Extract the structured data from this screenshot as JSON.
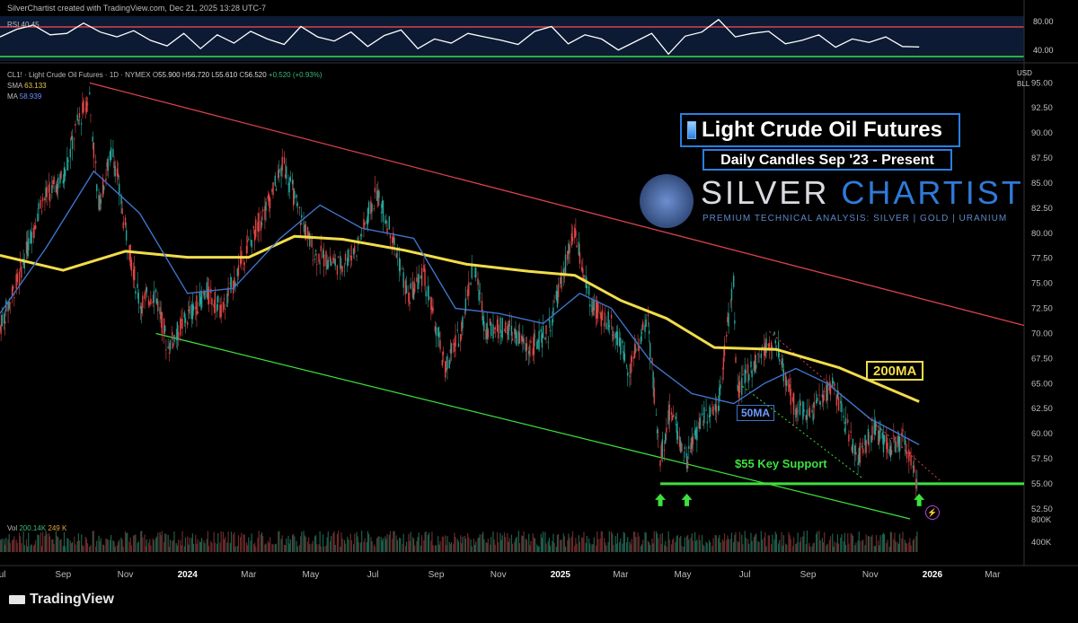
{
  "header": {
    "credit": "SilverChartist created with TradingView.com, Dec 21, 2025 13:28 UTC-7"
  },
  "legend": {
    "symbol_line": "CL1! · Light Crude Oil Futures · 1D · NYMEX",
    "ohlc": {
      "o_label": "O",
      "o": "55.900",
      "h_label": "H",
      "h": "56.720",
      "l_label": "L",
      "l": "55.610",
      "c_label": "C",
      "c": "56.520",
      "chg": "+0.520 (+0.93%)"
    },
    "sma_label": "SMA",
    "sma_value": "63.133",
    "ma_label": "MA",
    "ma_value": "58.939"
  },
  "rsi_panel": {
    "label": "RSI 40.45",
    "ticks": [
      "80.00",
      "40.00"
    ],
    "upper_color": "#e04545",
    "lower_color": "#3de03d"
  },
  "volume_panel": {
    "label": "Vol",
    "v1": "200.14K",
    "v2": "249 K",
    "ticks": [
      "800K",
      "400K"
    ]
  },
  "price_scale": {
    "currency": "USD",
    "unit": "BLL"
  },
  "annotations": {
    "title": "Light Crude Oil Futures",
    "subtitle": "Daily Candles Sep '23 - Present",
    "logo_word_a": "SILVER",
    "logo_word_b": "CHARTIST",
    "logo_tag": "PREMIUM TECHNICAL ANALYSIS: SILVER | GOLD | URANIUM",
    "ma200_tag": "200MA",
    "ma50_tag": "50MA",
    "support_label": "$55 Key Support",
    "bolt_icon": "lightning-icon"
  },
  "footer": {
    "brand": "TradingView",
    "brand_icon": "tradingview-logo-icon"
  },
  "colors": {
    "up": "#26a69a",
    "down": "#e04545",
    "ma200": "#f2dc4a",
    "ma50": "#3e73c9",
    "resistance": "#d9414f",
    "support_channel": "#3de03d",
    "support_line": "#3de03d",
    "arrows": "#3de03d"
  },
  "chart_data": {
    "type": "line",
    "title": "Light Crude Oil Futures",
    "subtitle": "Daily Candles Sep '23 - Present",
    "x_ticks": [
      "Jul",
      "Sep",
      "Nov",
      "2024",
      "Mar",
      "May",
      "Jul",
      "Sep",
      "Nov",
      "2025",
      "Mar",
      "May",
      "Jul",
      "Sep",
      "Nov",
      "2026",
      "Mar"
    ],
    "x_tick_dates": [
      "2023-07-01",
      "2023-09-01",
      "2023-11-01",
      "2024-01-01",
      "2024-03-01",
      "2024-05-01",
      "2024-07-01",
      "2024-09-01",
      "2024-11-01",
      "2025-01-01",
      "2025-03-01",
      "2025-05-01",
      "2025-07-01",
      "2025-09-01",
      "2025-11-01",
      "2026-01-01",
      "2026-03-01"
    ],
    "x_range": [
      "2023-07-01",
      "2026-04-01"
    ],
    "y_ticks": [
      95,
      92.5,
      90,
      87.5,
      85,
      82.5,
      80,
      77.5,
      75,
      72.5,
      70,
      67.5,
      65,
      62.5,
      60,
      57.5,
      55,
      52.5
    ],
    "ylim": [
      51.5,
      97
    ],
    "price_series": {
      "name": "CL1!",
      "points": [
        [
          "2023-07-01",
          70.5
        ],
        [
          "2023-07-20",
          75.6
        ],
        [
          "2023-08-10",
          83.0
        ],
        [
          "2023-09-01",
          85.5
        ],
        [
          "2023-09-15",
          90.8
        ],
        [
          "2023-09-27",
          93.7
        ],
        [
          "2023-10-06",
          82.8
        ],
        [
          "2023-10-20",
          88.5
        ],
        [
          "2023-11-01",
          80.5
        ],
        [
          "2023-11-16",
          73.0
        ],
        [
          "2023-12-01",
          74.1
        ],
        [
          "2023-12-13",
          68.6
        ],
        [
          "2024-01-01",
          71.6
        ],
        [
          "2024-01-20",
          74.1
        ],
        [
          "2024-02-05",
          72.3
        ],
        [
          "2024-02-28",
          78.3
        ],
        [
          "2024-03-20",
          82.8
        ],
        [
          "2024-04-05",
          87.0
        ],
        [
          "2024-04-20",
          82.0
        ],
        [
          "2024-05-05",
          78.0
        ],
        [
          "2024-05-30",
          76.8
        ],
        [
          "2024-06-15",
          78.5
        ],
        [
          "2024-07-05",
          84.0
        ],
        [
          "2024-07-20",
          80.0
        ],
        [
          "2024-08-05",
          73.5
        ],
        [
          "2024-08-20",
          76.0
        ],
        [
          "2024-09-10",
          66.5
        ],
        [
          "2024-09-25",
          70.0
        ],
        [
          "2024-10-08",
          77.0
        ],
        [
          "2024-10-20",
          70.5
        ],
        [
          "2024-11-10",
          70.5
        ],
        [
          "2024-12-01",
          68.5
        ],
        [
          "2024-12-20",
          70.0
        ],
        [
          "2025-01-15",
          80.0
        ],
        [
          "2025-02-01",
          72.5
        ],
        [
          "2025-02-20",
          71.0
        ],
        [
          "2025-03-10",
          66.5
        ],
        [
          "2025-03-28",
          71.5
        ],
        [
          "2025-04-09",
          57.5
        ],
        [
          "2025-04-20",
          62.5
        ],
        [
          "2025-05-05",
          57.2
        ],
        [
          "2025-05-20",
          61.5
        ],
        [
          "2025-06-05",
          63.0
        ],
        [
          "2025-06-20",
          75.0
        ],
        [
          "2025-06-24",
          64.0
        ],
        [
          "2025-07-10",
          67.0
        ],
        [
          "2025-07-30",
          69.5
        ],
        [
          "2025-08-20",
          62.5
        ],
        [
          "2025-09-05",
          62.0
        ],
        [
          "2025-09-25",
          65.0
        ],
        [
          "2025-10-20",
          57.5
        ],
        [
          "2025-11-05",
          60.5
        ],
        [
          "2025-11-20",
          58.5
        ],
        [
          "2025-12-05",
          59.5
        ],
        [
          "2025-12-16",
          55.3
        ],
        [
          "2025-12-19",
          56.52
        ]
      ]
    },
    "series": [
      {
        "name": "200MA",
        "points": [
          [
            "2023-07-01",
            77.8
          ],
          [
            "2023-09-01",
            76.3
          ],
          [
            "2023-11-01",
            78.2
          ],
          [
            "2024-01-01",
            77.6
          ],
          [
            "2024-03-01",
            77.6
          ],
          [
            "2024-04-15",
            79.7
          ],
          [
            "2024-06-01",
            79.4
          ],
          [
            "2024-08-01",
            78.3
          ],
          [
            "2024-10-01",
            76.9
          ],
          [
            "2024-12-01",
            76.2
          ],
          [
            "2025-01-15",
            75.8
          ],
          [
            "2025-03-01",
            73.3
          ],
          [
            "2025-04-15",
            71.5
          ],
          [
            "2025-06-01",
            68.6
          ],
          [
            "2025-08-01",
            68.4
          ],
          [
            "2025-10-01",
            66.6
          ],
          [
            "2025-12-19",
            63.2
          ]
        ]
      },
      {
        "name": "50MA",
        "points": [
          [
            "2023-07-01",
            72.0
          ],
          [
            "2023-08-15",
            78.5
          ],
          [
            "2023-10-01",
            86.2
          ],
          [
            "2023-11-15",
            82.0
          ],
          [
            "2024-01-01",
            74.0
          ],
          [
            "2024-02-15",
            74.5
          ],
          [
            "2024-04-01",
            79.5
          ],
          [
            "2024-05-10",
            82.8
          ],
          [
            "2024-06-20",
            80.5
          ],
          [
            "2024-08-10",
            79.5
          ],
          [
            "2024-09-20",
            72.5
          ],
          [
            "2024-11-01",
            72.0
          ],
          [
            "2024-12-15",
            71.0
          ],
          [
            "2025-01-20",
            74.0
          ],
          [
            "2025-02-20",
            72.5
          ],
          [
            "2025-04-01",
            67.0
          ],
          [
            "2025-05-10",
            64.0
          ],
          [
            "2025-06-20",
            63.0
          ],
          [
            "2025-07-20",
            65.0
          ],
          [
            "2025-08-20",
            66.5
          ],
          [
            "2025-09-20",
            65.0
          ],
          [
            "2025-11-01",
            61.5
          ],
          [
            "2025-12-19",
            58.9
          ]
        ]
      }
    ],
    "trendlines": [
      {
        "role": "descending-resistance",
        "from": [
          "2023-09-27",
          95.0
        ],
        "to": [
          "2026-04-01",
          70.8
        ]
      },
      {
        "role": "descending-support",
        "from": [
          "2023-12-01",
          70.0
        ],
        "to": [
          "2025-12-10",
          51.5
        ]
      },
      {
        "role": "key-support",
        "label": "$55 Key Support",
        "from": [
          "2025-04-09",
          55.0
        ],
        "to": [
          "2026-04-01",
          55.0
        ]
      }
    ],
    "rsi": {
      "label": "RSI",
      "last": 40.45,
      "levels": [
        70,
        30
      ],
      "ticks": [
        80,
        40
      ],
      "values": [
        55,
        66,
        72,
        58,
        60,
        75,
        62,
        55,
        64,
        50,
        42,
        60,
        38,
        58,
        46,
        63,
        52,
        44,
        70,
        55,
        49,
        62,
        41,
        57,
        65,
        38,
        52,
        46,
        60,
        55,
        50,
        44,
        63,
        70,
        45,
        58,
        52,
        36,
        48,
        60,
        30,
        56,
        62,
        80,
        55,
        60,
        63,
        45,
        50,
        58,
        40,
        52,
        47,
        55,
        41,
        40.45
      ]
    },
    "volume": {
      "label": "Vol",
      "last": "200.14K",
      "avg": "249 K",
      "ticks": [
        "800K",
        "400K"
      ]
    },
    "markers": [
      {
        "type": "up-arrow",
        "date": "2025-04-09",
        "value": 55.0
      },
      {
        "type": "up-arrow",
        "date": "2025-05-05",
        "value": 55.0
      },
      {
        "type": "up-arrow",
        "date": "2025-12-19",
        "value": 55.0
      }
    ],
    "grid": false,
    "legend_position": "top-left"
  }
}
